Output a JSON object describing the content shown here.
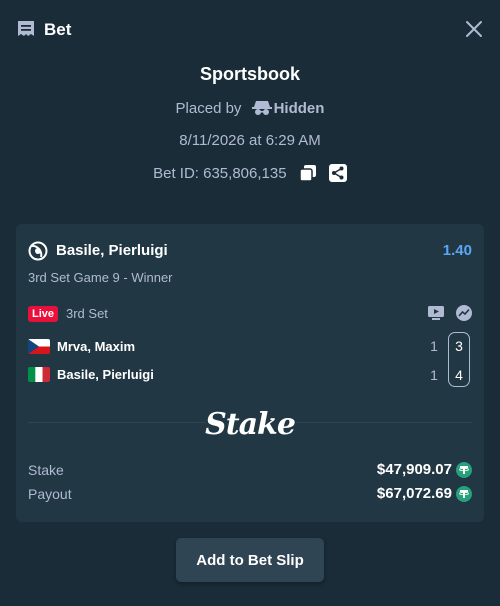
{
  "header": {
    "title": "Bet"
  },
  "summary": {
    "title": "Sportsbook",
    "placed_by_prefix": "Placed by",
    "placed_by_name": "Hidden",
    "datetime": "8/11/2026 at 6:29 AM",
    "bet_id": "Bet ID: 635,806,135"
  },
  "card": {
    "selection": "Basile, Pierluigi",
    "odds": "1.40",
    "market": "3rd Set Game 9 - Winner",
    "live_label": "Live",
    "period": "3rd Set",
    "teams": [
      {
        "name": "Mrva, Maxim",
        "flag": "cz-flag",
        "sets": "1",
        "current_set": "3"
      },
      {
        "name": "Basile, Pierluigi",
        "flag": "it-flag",
        "sets": "1",
        "current_set": "4"
      }
    ],
    "logo_text": "Stake",
    "stake_label": "Stake",
    "stake_value": "$47,909.07",
    "payout_label": "Payout",
    "payout_value": "$67,072.69",
    "currency_icon": "tether-icon"
  },
  "actions": {
    "add_to_slip": "Add to Bet Slip"
  },
  "colors": {
    "background": "#1a2c38",
    "card": "#213743",
    "odds": "#5aa6f5",
    "live": "#e9113c",
    "tether": "#26a17b"
  }
}
